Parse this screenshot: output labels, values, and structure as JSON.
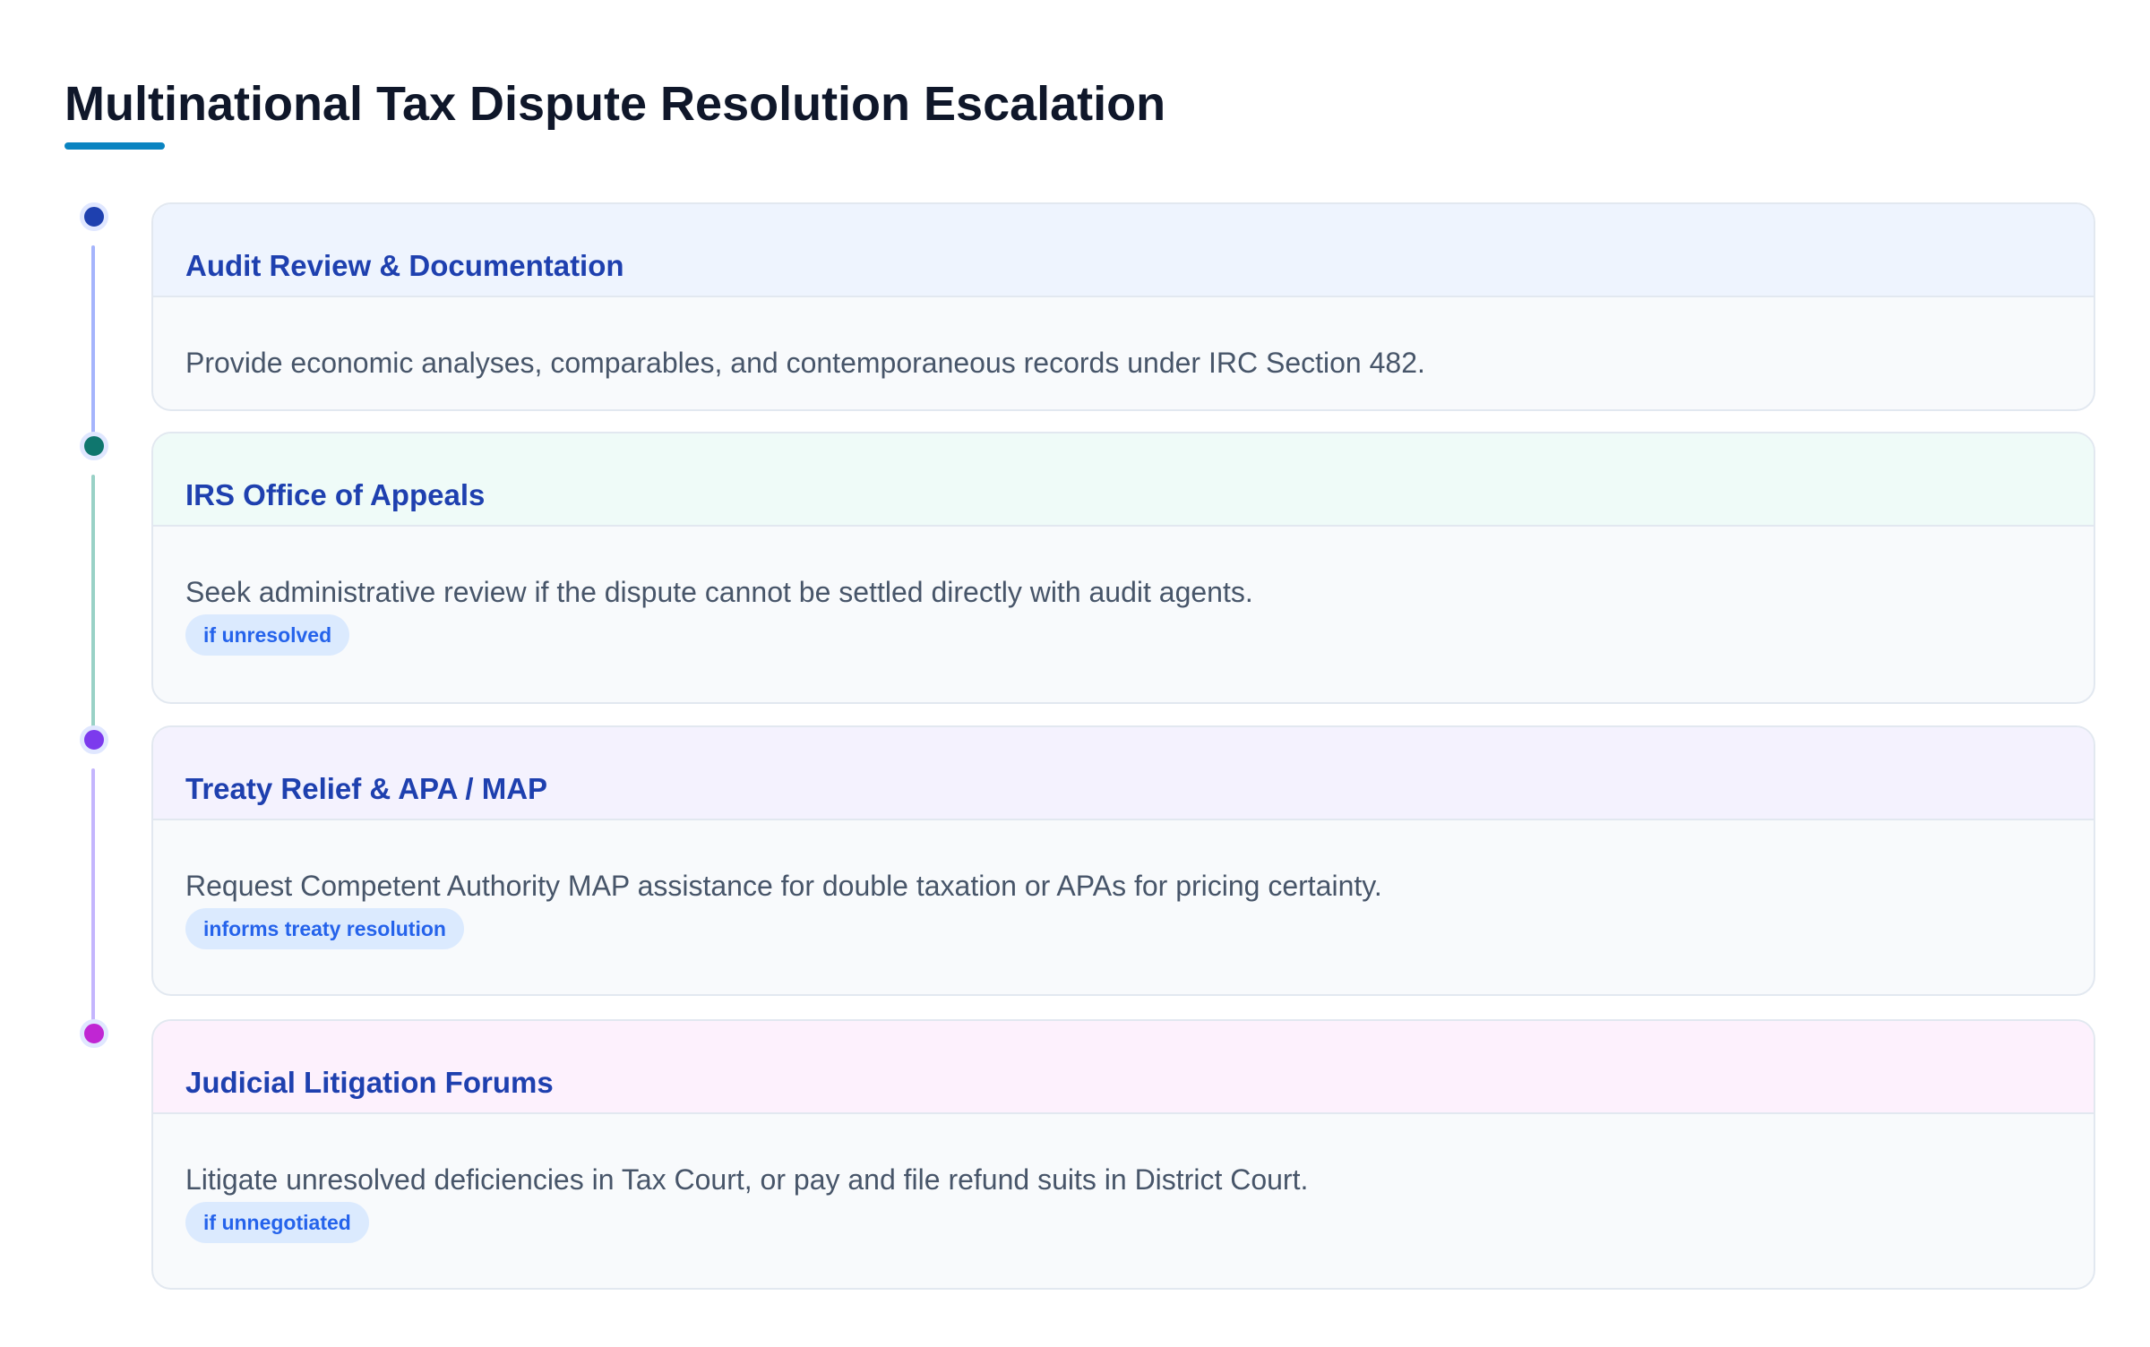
{
  "title": "Multinational Tax Dispute Resolution Escalation",
  "accent_color": "#0a84c1",
  "steps": [
    {
      "title": "Audit Review & Documentation",
      "description": "Provide economic analyses, comparables, and contemporaneous records under IRC Section 482.",
      "tag": null,
      "dot_color": "#1e40af",
      "line_color": "#a5b4fc",
      "header_bg": "#eef4fe"
    },
    {
      "title": "IRS Office of Appeals",
      "description": "Seek administrative review if the dispute cannot be settled directly with audit agents.",
      "tag": "if unresolved",
      "dot_color": "#0f766e",
      "line_color": "#99d1c6",
      "header_bg": "#effbf8"
    },
    {
      "title": "Treaty Relief & APA / MAP",
      "description": "Request Competent Authority MAP assistance for double taxation or APAs for pricing certainty.",
      "tag": "informs treaty resolution",
      "dot_color": "#7c3aed",
      "line_color": "#c4b5fd",
      "header_bg": "#f4f2fe"
    },
    {
      "title": "Judicial Litigation Forums",
      "description": "Litigate unresolved deficiencies in Tax Court, or pay and file refund suits in District Court.",
      "tag": "if unnegotiated",
      "dot_color": "#c026d3",
      "line_color": null,
      "header_bg": "#fdf1fd"
    }
  ]
}
